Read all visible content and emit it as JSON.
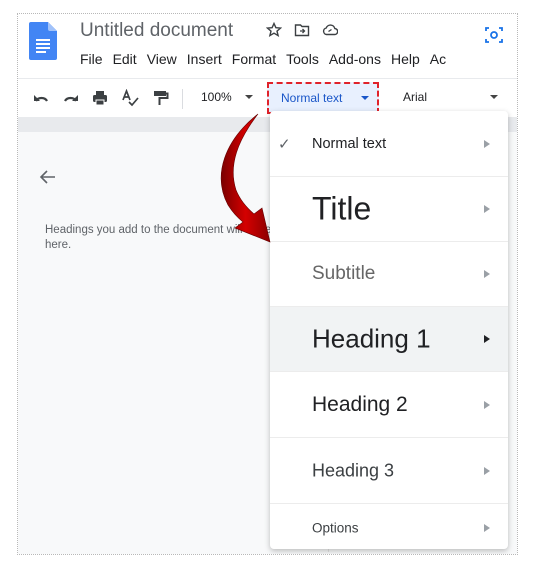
{
  "header": {
    "doc_title": "Untitled document",
    "title_icons": [
      "star-icon",
      "move-to-folder-icon",
      "cloud-status-icon"
    ],
    "corner_icon": "camera-scan-icon",
    "menu": [
      "File",
      "Edit",
      "View",
      "Insert",
      "Format",
      "Tools",
      "Add-ons",
      "Help",
      "Ac"
    ]
  },
  "toolbar": {
    "icons": [
      "undo-icon",
      "redo-icon",
      "print-icon",
      "spellcheck-icon",
      "paint-format-icon"
    ],
    "zoom": "100%",
    "style_value": "Normal text",
    "font_value": "Arial"
  },
  "outline": {
    "back_icon": "arrow-left-icon",
    "message": "Headings you add to the document will appear here."
  },
  "style_menu": {
    "items": [
      {
        "label": "Normal text",
        "checked": true,
        "highlighted": false
      },
      {
        "label": "Title",
        "checked": false,
        "highlighted": false
      },
      {
        "label": "Subtitle",
        "checked": false,
        "highlighted": false
      },
      {
        "label": "Heading 1",
        "checked": false,
        "highlighted": true
      },
      {
        "label": "Heading 2",
        "checked": false,
        "highlighted": false
      },
      {
        "label": "Heading 3",
        "checked": false,
        "highlighted": false
      },
      {
        "label": "Options",
        "checked": false,
        "highlighted": false
      }
    ],
    "check_glyph": "✓"
  },
  "annotation": {
    "highlight_color": "#e0222a",
    "arrow_color": "#c00000"
  }
}
